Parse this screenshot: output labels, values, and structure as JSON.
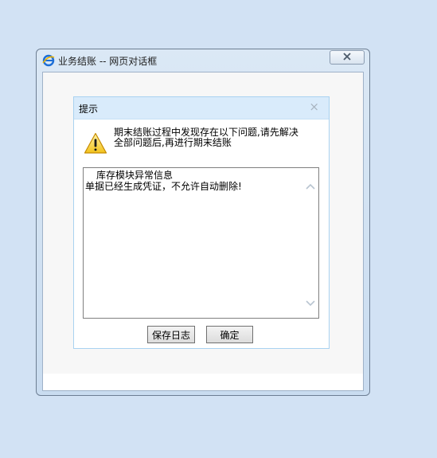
{
  "window": {
    "title": "业务结账 -- 网页对话框",
    "icon": "ie-icon",
    "close_icon": "close-icon"
  },
  "prompt": {
    "title": "提示",
    "close_glyph": "×",
    "message": "期末结账过程中发现存在以下问题,请先解决全部问题后,再进行期末结账",
    "warning_icon": "warning-icon",
    "log": {
      "lines": [
        "库存模块异常信息",
        "单据已经生成凭证，不允许自动删除!"
      ]
    },
    "buttons": {
      "save_log": "保存日志",
      "ok": "确定"
    }
  },
  "colors": {
    "desktop": "#d2e2f4",
    "prompt_header": "#d9ebfb",
    "prompt_border": "#a9d2f1"
  }
}
